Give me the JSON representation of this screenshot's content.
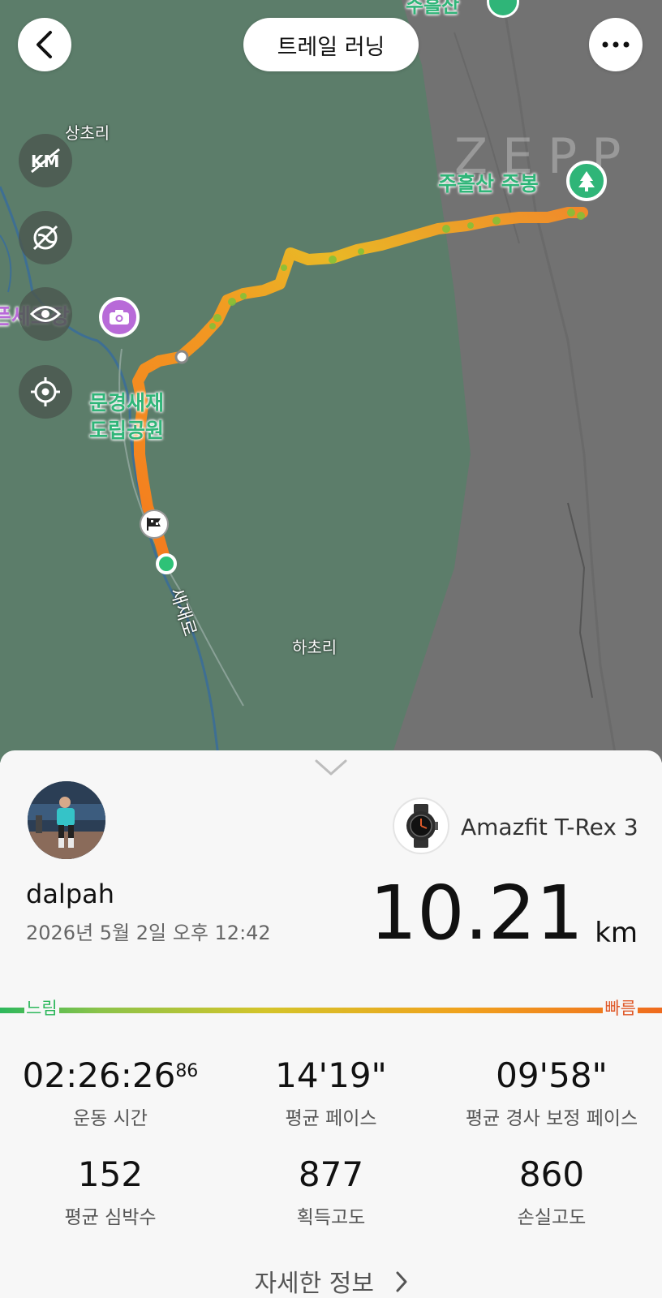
{
  "header": {
    "title": "트레일 러닝"
  },
  "map": {
    "watermark": "ZEPP",
    "labels": {
      "top_poi": "주흘산",
      "village_top": "상초리",
      "peak": "주흘산 주봉",
      "photo_spot": "픈세트장",
      "park_line1": "문경새재",
      "park_line2": "도립공원",
      "road": "새재로",
      "village_bottom": "하초리"
    },
    "controls": [
      "km-toggle-icon",
      "hide-layer-icon",
      "eye-icon",
      "locate-icon"
    ],
    "colors": {
      "forest": "#5c7d6a",
      "terrain": "#727272",
      "route_fast": "#f47a1e",
      "route_slow": "#7fc23a",
      "poi_green": "#2fb578",
      "poi_purple": "#b86ad8"
    }
  },
  "summary": {
    "username": "dalpah",
    "datetime": "2026년 5월 2일 오후 12:42",
    "device": "Amazfit T-Rex 3",
    "distance": "10.21",
    "distance_unit": "km",
    "pace_slow_label": "느림",
    "pace_fast_label": "빠름",
    "stats": [
      {
        "value": "02:26:26",
        "sub": "86",
        "label": "운동 시간"
      },
      {
        "value": "14'19\"",
        "sub": "",
        "label": "평균 페이스"
      },
      {
        "value": "09'58\"",
        "sub": "",
        "label": "평균 경사 보정 페이스"
      },
      {
        "value": "152",
        "sub": "",
        "label": "평균 심박수"
      },
      {
        "value": "877",
        "sub": "",
        "label": "획득고도"
      },
      {
        "value": "860",
        "sub": "",
        "label": "손실고도"
      }
    ],
    "details_label": "자세한 정보"
  }
}
